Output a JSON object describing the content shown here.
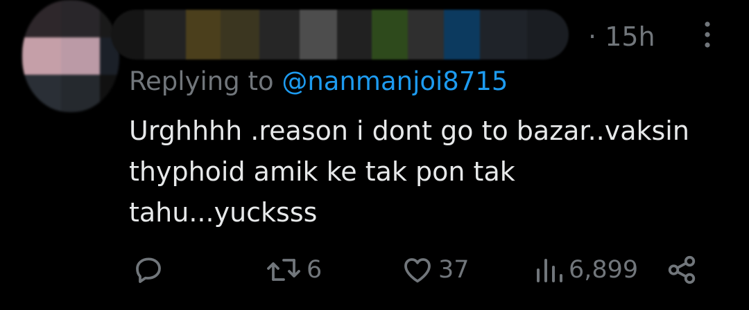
{
  "tweet": {
    "time_separator": "·",
    "time": "15h",
    "replying_prefix": "Replying to ",
    "replying_handle": "@nanmanjoi8715",
    "text": "Urghhhh .reason i dont go to bazar..vaksin\nthyphoid amik ke tak pon tak\ntahu...yucksss"
  },
  "actions": {
    "reply_icon": "reply-icon",
    "retweet_icon": "retweet-icon",
    "retweet_count": "6",
    "like_icon": "heart-icon",
    "like_count": "37",
    "views_icon": "views-icon",
    "views_count": "6,899",
    "share_icon": "share-icon"
  },
  "avatar_pixels": [
    "#2e272b",
    "#29262a",
    "#1a1a1a",
    "#c59fa8",
    "#bb9aa6",
    "#1b2028",
    "#2a2f36",
    "#25292e",
    "#111111"
  ],
  "name_pixels": [
    "#151515",
    "#232323",
    "#4b3f1c",
    "#3b3620",
    "#262626",
    "#4d4d4d",
    "#212121",
    "#2e4a1c",
    "#2f2f2f",
    "#0c3a5f",
    "#1f2329",
    "#1a1d22"
  ],
  "colors": {
    "background": "#000000",
    "text": "#e7e9ea",
    "muted": "#71767b",
    "accent": "#1d9bf0"
  }
}
